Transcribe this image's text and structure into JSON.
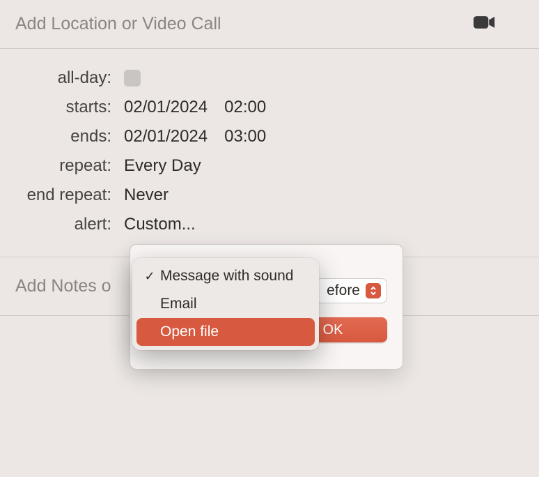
{
  "location": {
    "placeholder": "Add Location or Video Call"
  },
  "fields": {
    "all_day": {
      "label": "all-day:",
      "checked": false
    },
    "starts": {
      "label": "starts:",
      "date": "02/01/2024",
      "time": "02:00"
    },
    "ends": {
      "label": "ends:",
      "date": "02/01/2024",
      "time": "03:00"
    },
    "repeat": {
      "label": "repeat:",
      "value": "Every Day"
    },
    "end_repeat": {
      "label": "end repeat:",
      "value": "Never"
    },
    "alert": {
      "label": "alert:",
      "value": "Custom..."
    }
  },
  "notes": {
    "placeholder_visible": "Add Notes o"
  },
  "custom_alert_popup": {
    "timing_select_visible_text": "efore",
    "buttons": {
      "ok": "OK"
    }
  },
  "alert_type_menu": {
    "items": [
      {
        "label": "Message with sound",
        "checked": true,
        "highlighted": false
      },
      {
        "label": "Email",
        "checked": false,
        "highlighted": false
      },
      {
        "label": "Open file",
        "checked": false,
        "highlighted": true
      }
    ]
  }
}
